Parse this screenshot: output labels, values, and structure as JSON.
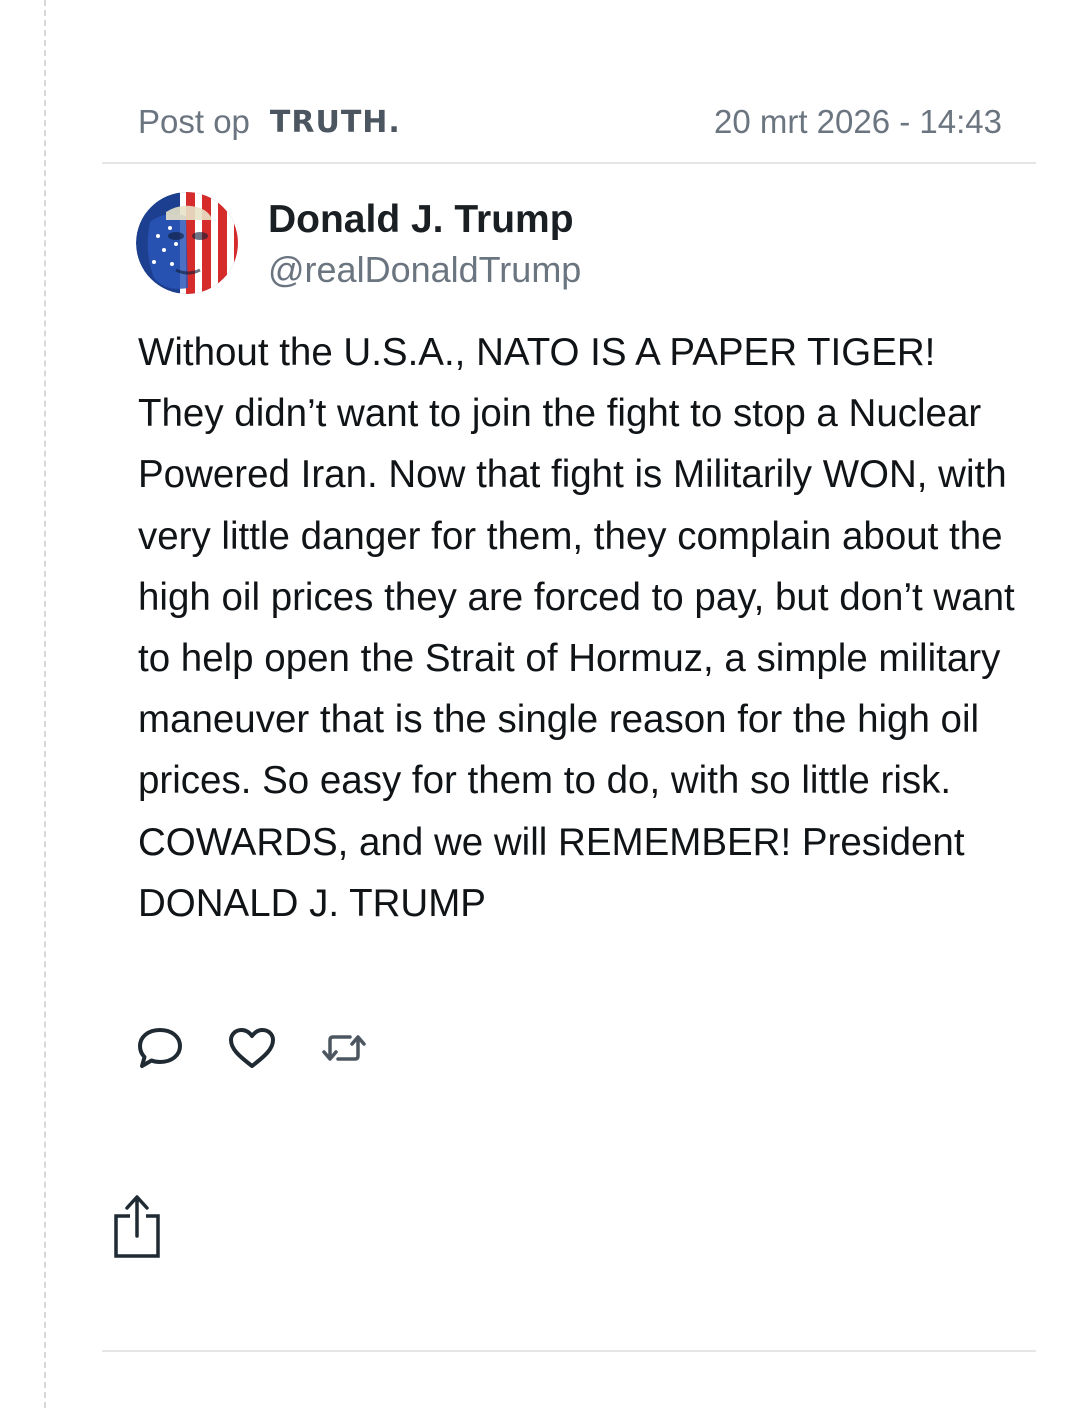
{
  "header": {
    "post_label": "Post op",
    "brand": "TRUTH.",
    "timestamp": "20 mrt 2026 - 14:43"
  },
  "author": {
    "display_name": "Donald J. Trump",
    "handle": "@realDonaldTrump"
  },
  "post": {
    "text": "Without the U.S.A., NATO IS A PAPER TIGER! They didn’t want to join the fight to stop a Nuclear Powered Iran. Now that fight is Militarily WON, with very little danger for them, they complain about the high oil prices they are forced to pay, but don’t want to help open the Strait of Hormuz, a simple military maneuver that is the single reason for the high oil prices. So easy for them to do, with so little risk. COWARDS, and we will REMEMBER! President DONALD J. TRUMP"
  },
  "actions": [
    {
      "icon": "comment-icon"
    },
    {
      "icon": "heart-icon"
    },
    {
      "icon": "repost-icon"
    }
  ],
  "share": {
    "icon": "share-icon"
  },
  "colors": {
    "text_primary": "#111417",
    "text_secondary": "#6b7580",
    "divider": "#e4e6e8",
    "brand": "#4b5660"
  }
}
